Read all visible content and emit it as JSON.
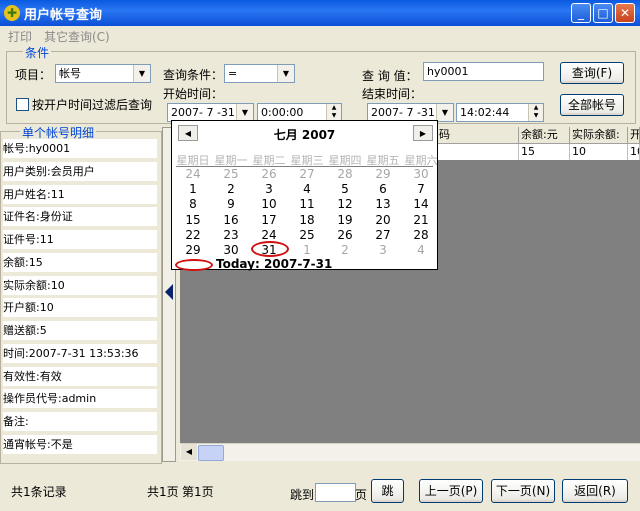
{
  "window": {
    "title": "用户帐号查询",
    "minimize": "_",
    "maximize": "□",
    "close": "✕"
  },
  "menu": {
    "print": "打印",
    "other_query": "其它查询(C)"
  },
  "conditions": {
    "group_title": "条件",
    "item_label": "项目：",
    "item_value": "帐号",
    "criteria_label": "查询条件：",
    "criteria_value": "=",
    "query_value_label": "查 询 值：",
    "query_value": "hy0001",
    "query_button": "查询(F)",
    "filter_checkbox_label": "按开户时间过滤后查询",
    "filter_checked": false,
    "start_label": "开始时间：",
    "start_date": "2007- 7 -31",
    "start_time": "0:00:00",
    "end_label": "结束时间：",
    "end_date": "2007- 7 -31",
    "end_time": "14:02:44",
    "all_accounts_button": "全部帐号"
  },
  "detail": {
    "group_title": "单个帐号明细",
    "rows": [
      "帐号:hy0001",
      "用户类别:会员用户",
      "用户姓名:11",
      "证件名:身份证",
      "证件号:11",
      "余额:15",
      "实际余额:10",
      "开户额:10",
      "赠送额:5",
      "时间:2007-7-31 13:53:36",
      "有效性:有效",
      "操作员代号:admin",
      "备注:",
      "通宵帐号:不是"
    ]
  },
  "grid": {
    "columns": [
      "码",
      "余额:元",
      "实际余额:",
      "开"
    ],
    "row": [
      "",
      "15",
      "10",
      "10"
    ]
  },
  "calendar": {
    "prev": "◀",
    "next": "▶",
    "month_title": "七月 2007",
    "weekdays": [
      "星期日",
      "星期一",
      "星期二",
      "星期三",
      "星期四",
      "星期五",
      "星期六"
    ],
    "weeks": [
      [
        "24",
        "25",
        "26",
        "27",
        "28",
        "29",
        "30"
      ],
      [
        "1",
        "2",
        "3",
        "4",
        "5",
        "6",
        "7"
      ],
      [
        "8",
        "9",
        "10",
        "11",
        "12",
        "13",
        "14"
      ],
      [
        "15",
        "16",
        "17",
        "18",
        "19",
        "20",
        "21"
      ],
      [
        "22",
        "23",
        "24",
        "25",
        "26",
        "27",
        "28"
      ],
      [
        "29",
        "30",
        "31",
        "1",
        "2",
        "3",
        "4"
      ]
    ],
    "today_label": "Today: 2007-7-31"
  },
  "footer": {
    "record_count": "共1条记录",
    "pages": "共1页",
    "current_page": "第1页",
    "jump_label": "跳到",
    "page_unit": "页",
    "jump_button": "跳",
    "prev_button": "上一页(P)",
    "next_button": "下一页(N)",
    "back_button": "返回(R)"
  }
}
